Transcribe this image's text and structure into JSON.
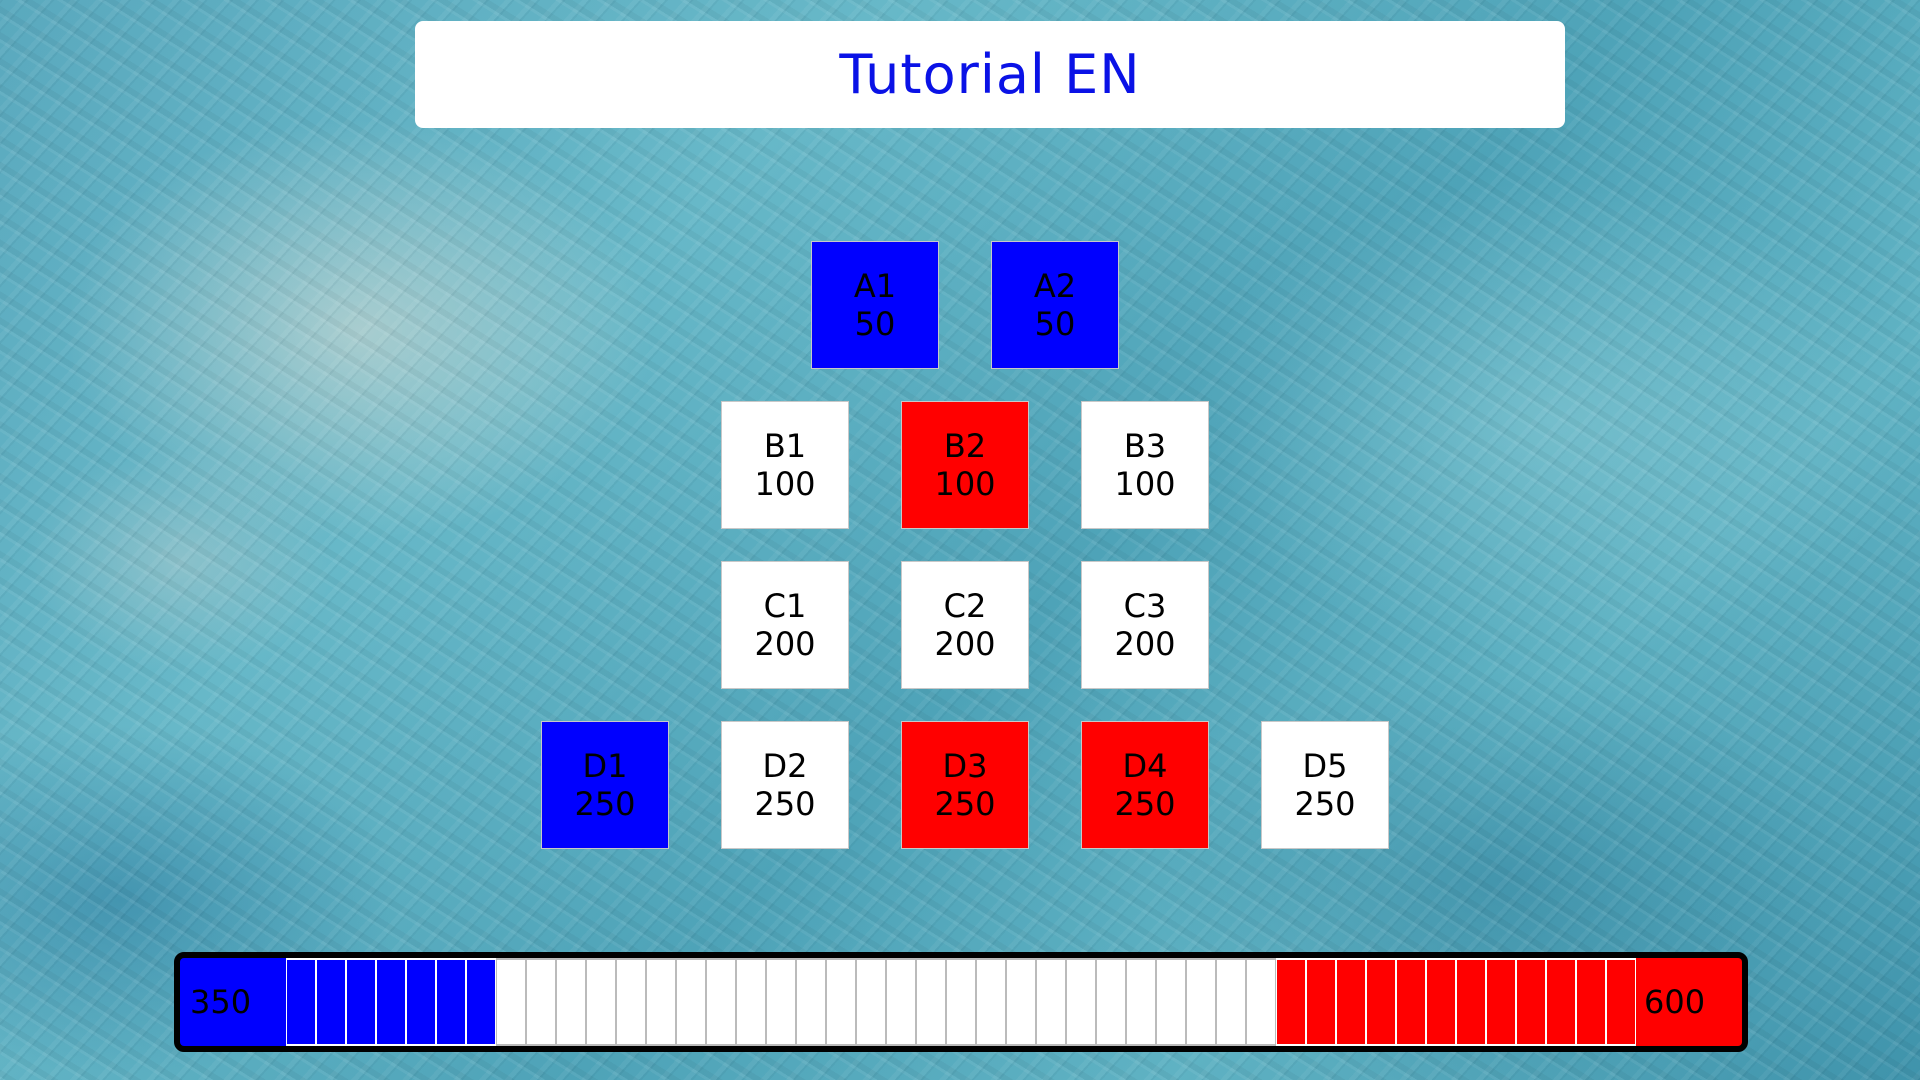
{
  "title": "Tutorial EN",
  "colors": {
    "blue": "#0000ff",
    "red": "#ff0000",
    "white": "#ffffff",
    "title": "#0a12e6"
  },
  "tiles": [
    {
      "id": "A1",
      "value": "50",
      "state": "blue"
    },
    {
      "id": "A2",
      "value": "50",
      "state": "blue"
    },
    {
      "id": "B1",
      "value": "100",
      "state": "white"
    },
    {
      "id": "B2",
      "value": "100",
      "state": "red"
    },
    {
      "id": "B3",
      "value": "100",
      "state": "white"
    },
    {
      "id": "C1",
      "value": "200",
      "state": "white"
    },
    {
      "id": "C2",
      "value": "200",
      "state": "white"
    },
    {
      "id": "C3",
      "value": "200",
      "state": "white"
    },
    {
      "id": "D1",
      "value": "250",
      "state": "blue"
    },
    {
      "id": "D2",
      "value": "250",
      "state": "white"
    },
    {
      "id": "D3",
      "value": "250",
      "state": "red"
    },
    {
      "id": "D4",
      "value": "250",
      "state": "red"
    },
    {
      "id": "D5",
      "value": "250",
      "state": "white"
    }
  ],
  "score": {
    "blue": "350",
    "red": "600",
    "segments_total": 45,
    "segments_blue": 7,
    "segments_red": 12
  }
}
